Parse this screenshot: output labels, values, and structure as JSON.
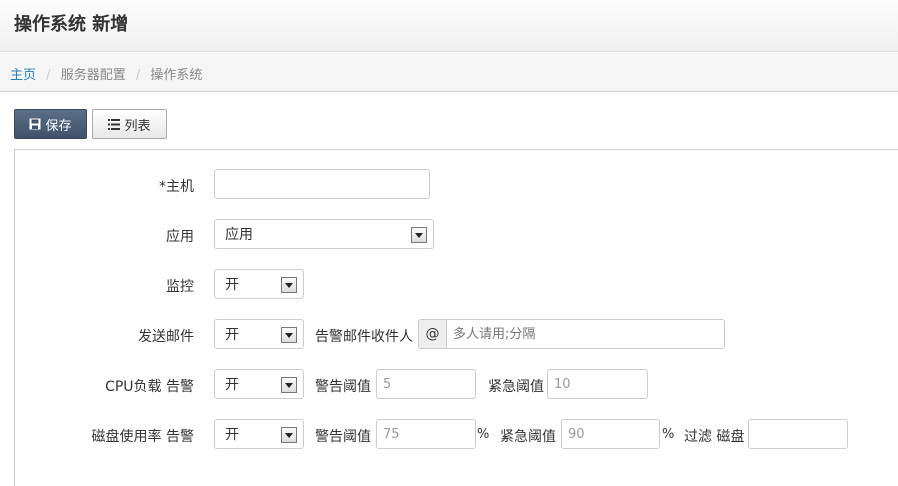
{
  "header": {
    "title": "操作系统 新增"
  },
  "breadcrumb": {
    "home": "主页",
    "section": "服务器配置",
    "current": "操作系统",
    "separator": "/"
  },
  "toolbar": {
    "save_label": "保存",
    "list_label": "列表"
  },
  "form": {
    "host": {
      "label": "*主机",
      "value": ""
    },
    "app": {
      "label": "应用",
      "selected": "应用"
    },
    "monitor": {
      "label": "监控",
      "selected": "开"
    },
    "email": {
      "label": "发送邮件",
      "selected": "开",
      "recipients_label": "告警邮件收件人",
      "addon": "@",
      "recipients_placeholder": "多人请用;分隔"
    },
    "cpu": {
      "label": "CPU负载 告警",
      "selected": "开",
      "warn_label": "警告阈值",
      "warn_value": "5",
      "crit_label": "紧急阈值",
      "crit_value": "10"
    },
    "disk": {
      "label": "磁盘使用率 告警",
      "selected": "开",
      "warn_label": "警告阈值",
      "warn_value": "75",
      "warn_unit": "%",
      "crit_label": "紧急阈值",
      "crit_value": "90",
      "crit_unit": "%",
      "filter_label": "过滤 磁盘",
      "filter_value": ""
    }
  }
}
